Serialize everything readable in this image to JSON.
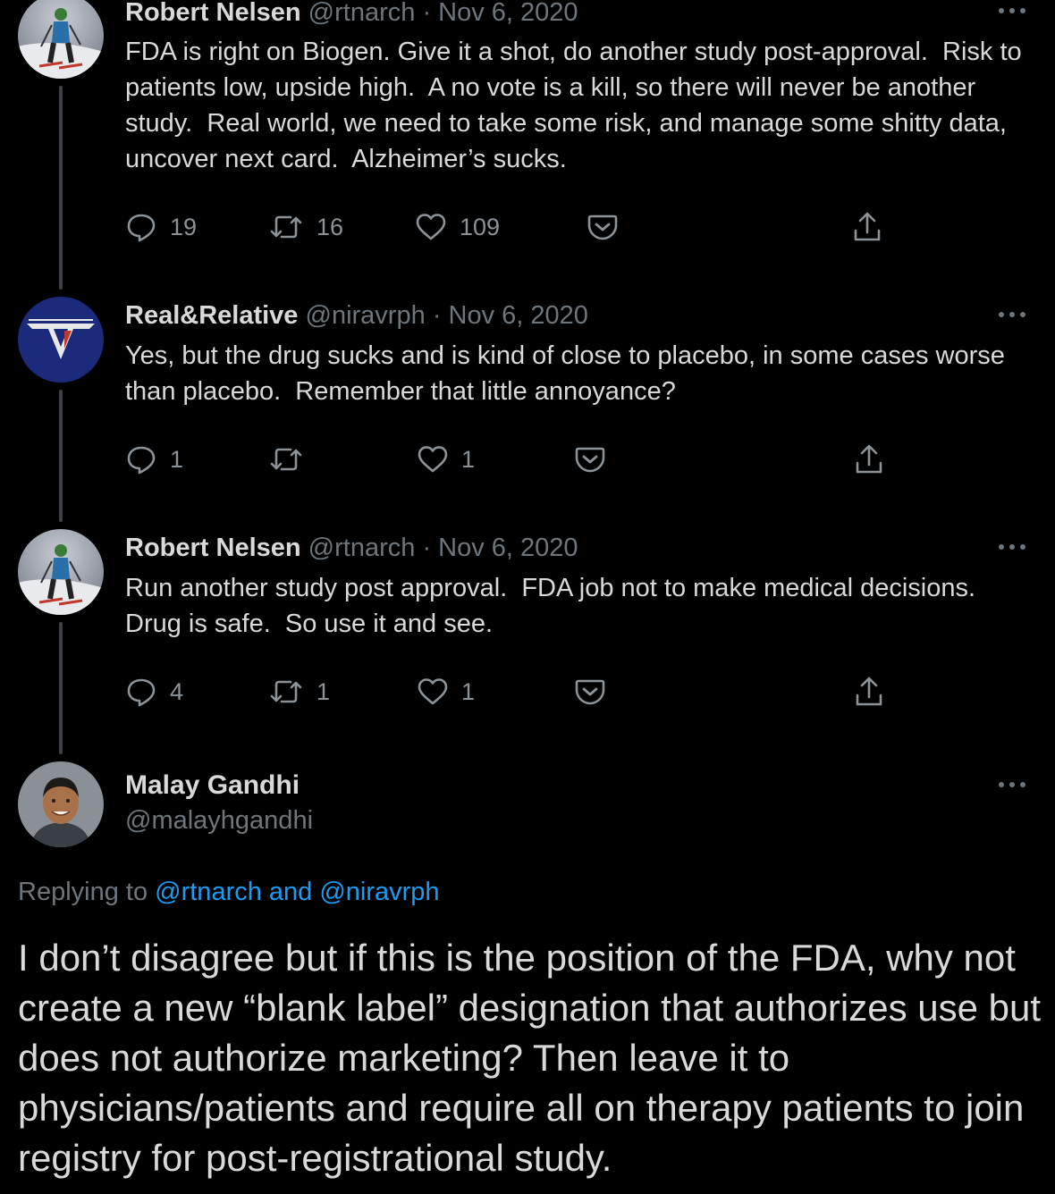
{
  "colors": {
    "background": "#000000",
    "text_primary": "#D9D9D9",
    "text_secondary": "#6E767D",
    "link": "#1D9BF0",
    "thread_line": "#3D4145"
  },
  "tweets": [
    {
      "name": "Robert Nelsen",
      "handle": "@rtnarch",
      "separator": "·",
      "date": "Nov 6, 2020",
      "text": "FDA is right on Biogen. Give it a shot, do another study post-approval.  Risk to patients low, upside high.  A no vote is a kill, so there will never be another study.  Real world, we need to take some risk, and manage some shitty data, uncover next card.  Alzheimer’s sucks.",
      "replies": "19",
      "retweets": "16",
      "likes": "109",
      "avatar_icon": "skier-avatar"
    },
    {
      "name": "Real&Relative",
      "handle": "@niravrph",
      "separator": "·",
      "date": "Nov 6, 2020",
      "text": "Yes, but the drug sucks and is kind of close to placebo, in some cases worse than placebo.  Remember that little annoyance?",
      "replies": "1",
      "retweets": "",
      "likes": "1",
      "avatar_icon": "van-halen-logo-avatar"
    },
    {
      "name": "Robert Nelsen",
      "handle": "@rtnarch",
      "separator": "·",
      "date": "Nov 6, 2020",
      "text": "Run another study post approval.  FDA job not to make medical decisions.  Drug is safe.  So use it and see.",
      "replies": "4",
      "retweets": "1",
      "likes": "1",
      "avatar_icon": "skier-avatar"
    }
  ],
  "main_tweet": {
    "name": "Malay Gandhi",
    "handle": "@malayhgandhi",
    "replying_prefix": "Replying to ",
    "replying_targets": "@rtnarch and @niravrph",
    "text": "I don’t disagree but if this is the position of the FDA, why not create a new “blank label” designation that authorizes use but does not authorize marketing? Then leave it to physicians/patients and require all on therapy patients to join registry for post-registrational study.",
    "avatar_icon": "person-portrait-avatar"
  },
  "icons": {
    "reply": "reply-icon",
    "retweet": "retweet-icon",
    "like": "heart-icon",
    "save": "pocket-save-icon",
    "share": "share-icon",
    "more": "more-options-icon"
  }
}
